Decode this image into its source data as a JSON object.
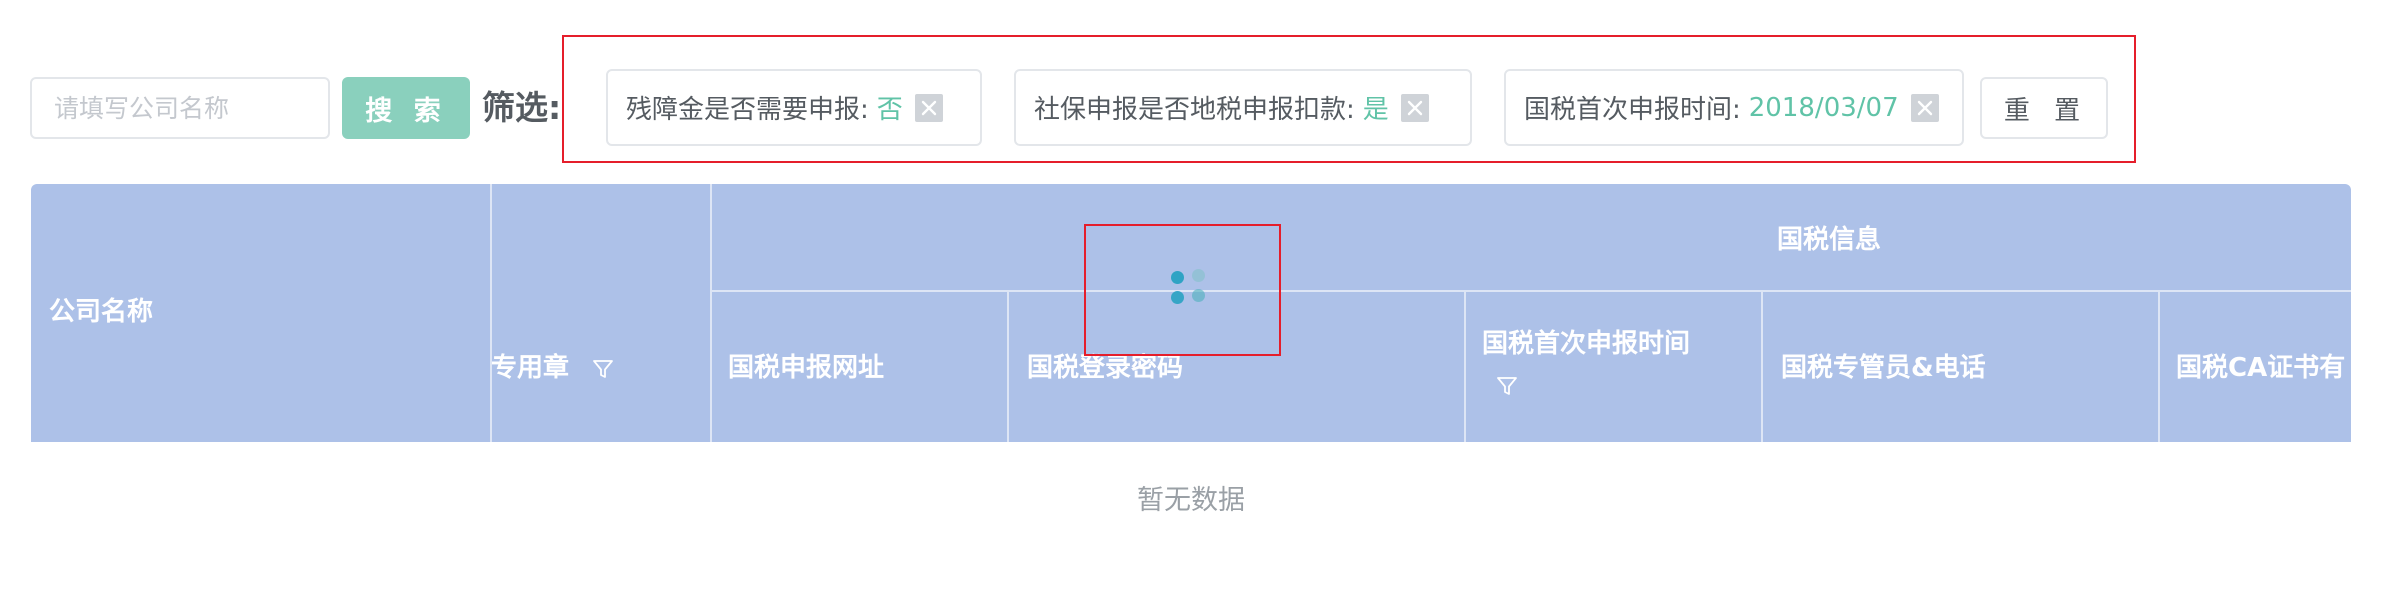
{
  "search": {
    "placeholder": "请填写公司名称",
    "value": "",
    "button_label": "搜 索"
  },
  "filter": {
    "label": "筛选:",
    "tags": [
      {
        "key": "残障金是否需要申报:",
        "value": "否"
      },
      {
        "key": "社保申报是否地税申报扣款:",
        "value": "是"
      },
      {
        "key": "国税首次申报时间:",
        "value": "2018/03/07"
      }
    ],
    "reset_label": "重 置"
  },
  "table": {
    "fixed_column": "公司名称",
    "group_header": "国税信息",
    "columns": [
      "专用章",
      "国税申报网址",
      "国税登录密码",
      "国税首次申报时间",
      "国税专管员&电话",
      "国税CA证书有"
    ],
    "empty_text": "暂无数据"
  },
  "colors": {
    "accent": "#8ad0bd",
    "tag_value": "#60c3a7",
    "header_bg": "#adc1e8",
    "highlight": "#e51e2b",
    "loader": "#2fa3c4"
  },
  "icons": {
    "tag_close": "close-icon",
    "column_filter": "filter-icon",
    "loading": "loading-spinner"
  }
}
